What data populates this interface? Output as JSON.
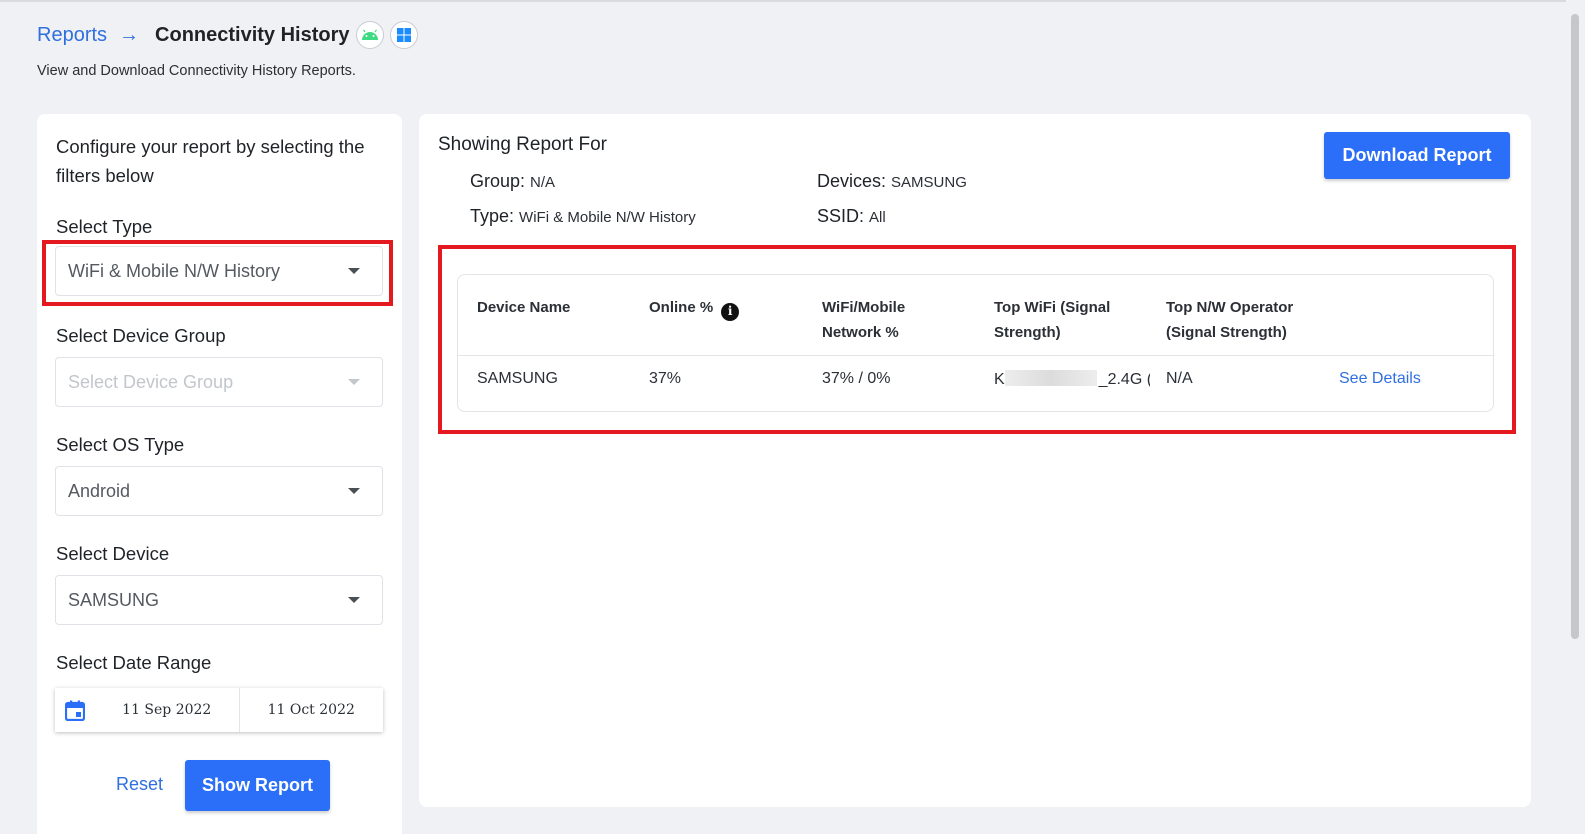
{
  "header": {
    "breadcrumb_root": "Reports",
    "breadcrumb_arrow": "→",
    "page_title": "Connectivity History",
    "os_badges": [
      "android-icon",
      "windows-icon"
    ],
    "subtitle": "View and Download Connectivity History Reports."
  },
  "filters": {
    "intro": "Configure your report by selecting the filters below",
    "type_label": "Select Type",
    "type_value": "WiFi & Mobile N/W History",
    "device_group_label": "Select Device Group",
    "device_group_placeholder": "Select Device Group",
    "os_type_label": "Select OS Type",
    "os_type_value": "Android",
    "device_label": "Select Device",
    "device_value": "SAMSUNG",
    "date_range_label": "Select Date Range",
    "date_from": "11 Sep 2022",
    "date_to": "11 Oct 2022",
    "reset_label": "Reset",
    "show_report_label": "Show Report"
  },
  "report": {
    "title": "Showing Report For",
    "group_label": "Group:",
    "group_value": "N/A",
    "devices_label": "Devices:",
    "devices_value": "SAMSUNG",
    "type_label": "Type:",
    "type_value": "WiFi & Mobile N/W History",
    "ssid_label": "SSID:",
    "ssid_value": "All",
    "download_label": "Download Report",
    "columns": [
      "Device Name",
      "Online %",
      "WiFi/Mobile Network %",
      "Top WiFi (Signal Strength)",
      "Top N/W Operator (Signal Strength)"
    ],
    "rows": [
      {
        "device_name": "SAMSUNG",
        "online": "37%",
        "wifi_mobile": "37% / 0%",
        "top_wifi_prefix": "K",
        "top_wifi_suffix": "_2.4G (",
        "top_operator": "N/A",
        "action": "See Details"
      }
    ]
  },
  "colors": {
    "accent": "#2b6ef7",
    "link": "#2f6fe0",
    "highlight": "#e3191f",
    "background": "#f0f1f4"
  }
}
